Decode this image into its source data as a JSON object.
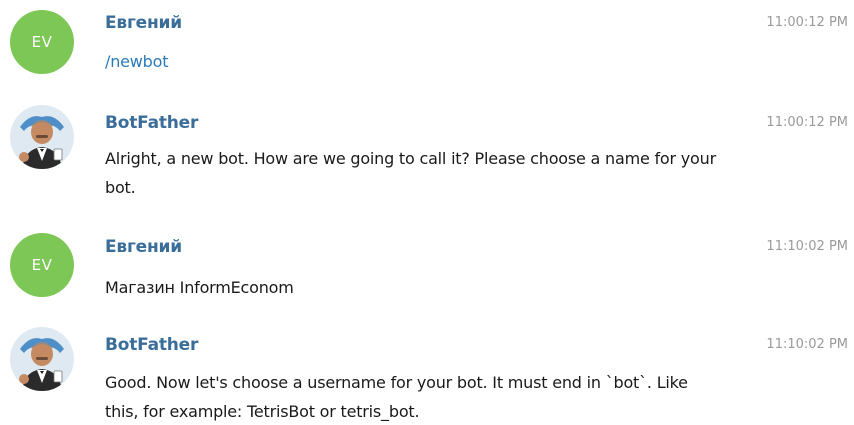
{
  "messages": [
    {
      "sender": "Евгений",
      "avatar_initials": "EV",
      "time": "11:00:12 PM",
      "text": "/newbot"
    },
    {
      "sender": "BotFather",
      "avatar_icon": "botfather-avatar-icon",
      "time": "11:00:12 PM",
      "text": "Alright, a new bot. How are we going to call it? Please choose a name for your bot."
    },
    {
      "sender": "Евгений",
      "avatar_initials": "EV",
      "time": "11:10:02 PM",
      "text": "Магазин InformEconom"
    },
    {
      "sender": "BotFather",
      "avatar_icon": "botfather-avatar-icon",
      "time": "11:10:02 PM",
      "text": "Good. Now let's choose a username for your bot. It must end in `bot`. Like this, for example: TetrisBot or tetris_bot."
    }
  ],
  "colors": {
    "initials_avatar_bg": "#7cc755",
    "sender_name": "#3a6d99",
    "command_link": "#2b7ab8",
    "timestamp": "#9a9a9a"
  }
}
